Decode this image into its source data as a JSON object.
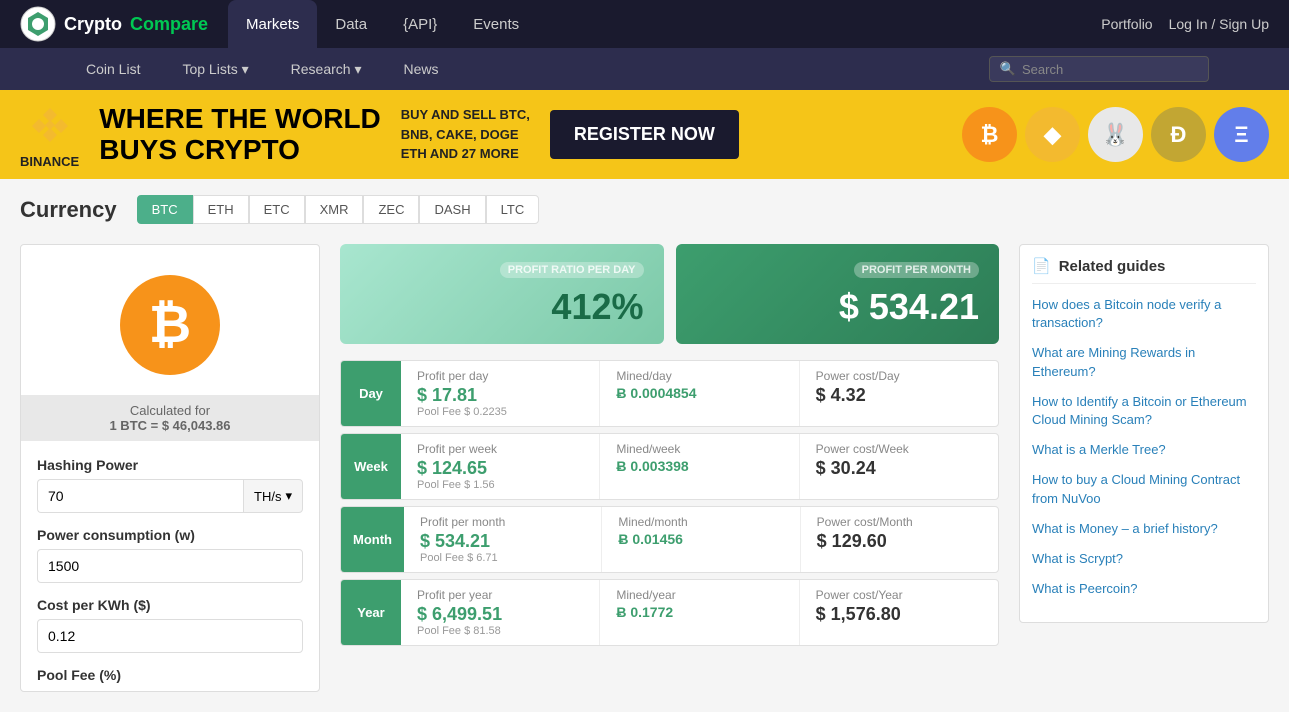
{
  "logo": {
    "crypto": "Crypto",
    "compare": "Compare",
    "icon_label": "cryptocompare-logo"
  },
  "topNav": {
    "tabs": [
      {
        "label": "Markets",
        "active": true
      },
      {
        "label": "Data",
        "active": false
      },
      {
        "label": "{API}",
        "active": false
      },
      {
        "label": "Events",
        "active": false
      }
    ],
    "right": {
      "portfolio": "Portfolio",
      "login": "Log In / Sign Up"
    }
  },
  "secondaryNav": {
    "items": [
      {
        "label": "Coin List"
      },
      {
        "label": "Top Lists ▾"
      },
      {
        "label": "Research ▾"
      },
      {
        "label": "News"
      }
    ],
    "search_placeholder": "Search"
  },
  "banner": {
    "brand": "BINANCE",
    "headline": "WHERE THE WORLD\nBUYS CRYPTO",
    "sub": "BUY AND SELL BTC,\nBNB, CAKE, DOGE\nETH AND 27 MORE",
    "cta": "REGISTER NOW"
  },
  "page": {
    "title": "Currency",
    "tabs": [
      "BTC",
      "ETH",
      "ETC",
      "XMR",
      "ZEC",
      "DASH",
      "LTC"
    ],
    "active_tab": "BTC"
  },
  "calc": {
    "rate_label": "Calculated for",
    "rate_value": "1 BTC = $ 46,043.86",
    "hashing_power_label": "Hashing Power",
    "hashing_power_value": "70",
    "hashing_unit": "TH/s",
    "power_consumption_label": "Power consumption (w)",
    "power_consumption_value": "1500",
    "cost_kwh_label": "Cost per KWh ($)",
    "cost_kwh_value": "0.12",
    "pool_fee_label": "Pool Fee (%)"
  },
  "profitCards": {
    "day": {
      "label": "PROFIT RATIO PER DAY",
      "value": "412%"
    },
    "month": {
      "label": "PROFIT PER MONTH",
      "value": "$ 534.21"
    }
  },
  "miningRows": [
    {
      "period": "Day",
      "profit_title": "Profit per day",
      "profit_value": "$ 17.81",
      "pool_fee": "Pool Fee $ 0.2235",
      "mined_title": "Mined/day",
      "mined_value": "Ƀ 0.0004854",
      "power_title": "Power cost/Day",
      "power_value": "$ 4.32"
    },
    {
      "period": "Week",
      "profit_title": "Profit per week",
      "profit_value": "$ 124.65",
      "pool_fee": "Pool Fee $ 1.56",
      "mined_title": "Mined/week",
      "mined_value": "Ƀ 0.003398",
      "power_title": "Power cost/Week",
      "power_value": "$ 30.24"
    },
    {
      "period": "Month",
      "profit_title": "Profit per month",
      "profit_value": "$ 534.21",
      "pool_fee": "Pool Fee $ 6.71",
      "mined_title": "Mined/month",
      "mined_value": "Ƀ 0.01456",
      "power_title": "Power cost/Month",
      "power_value": "$ 129.60"
    },
    {
      "period": "Year",
      "profit_title": "Profit per year",
      "profit_value": "$ 6,499.51",
      "pool_fee": "Pool Fee $ 81.58",
      "mined_title": "Mined/year",
      "mined_value": "Ƀ 0.1772",
      "power_title": "Power cost/Year",
      "power_value": "$ 1,576.80"
    }
  ],
  "relatedGuides": {
    "title": "Related guides",
    "items": [
      {
        "text": "How does a Bitcoin node verify a transaction?",
        "type": "link"
      },
      {
        "text": "What are Mining Rewards in Ethereum?",
        "type": "link"
      },
      {
        "text": "How to Identify a Bitcoin or Ethereum Cloud Mining Scam?",
        "type": "link"
      },
      {
        "text": "What is a Merkle Tree?",
        "type": "link"
      },
      {
        "text": "How to buy a Cloud Mining Contract from NuVoo",
        "type": "link"
      },
      {
        "text": "What is Money – a brief history?",
        "type": "mixed"
      },
      {
        "text": "What is Scrypt?",
        "type": "link"
      },
      {
        "text": "What is Peercoin?",
        "type": "link"
      }
    ]
  }
}
